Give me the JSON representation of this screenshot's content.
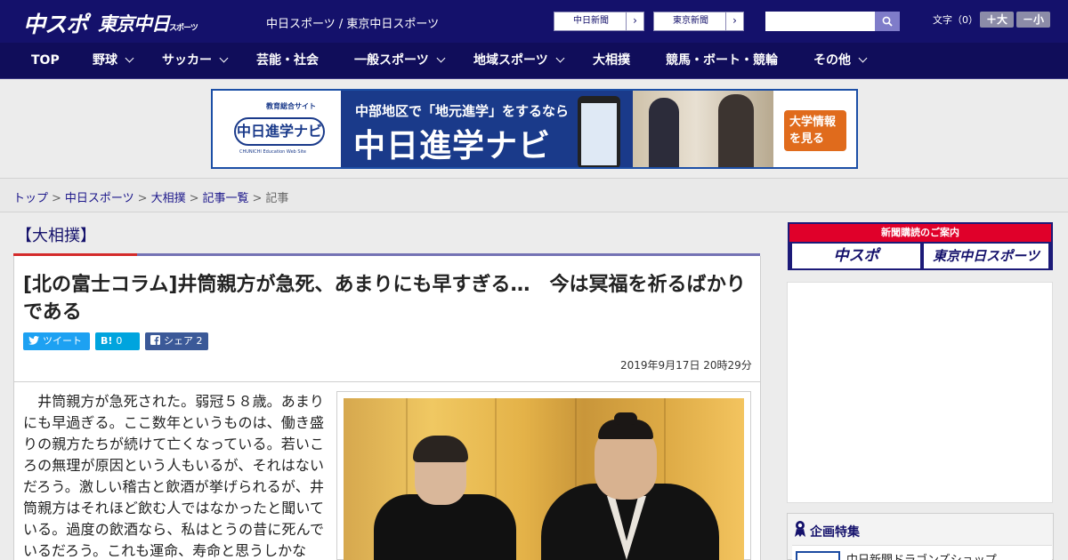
{
  "header": {
    "logo_chuspo": "中スポ",
    "logo_tokyo": "東京中日",
    "logo_tokyo_small": "スポーツ",
    "site_title": "中日スポーツ / 東京中日スポーツ",
    "ext_link_1": "中日新聞",
    "ext_link_2": "東京新聞",
    "ext_arrow": "›",
    "search_placeholder": "",
    "font_size_label": "文字（0）",
    "font_larger": "＋大",
    "font_smaller": "－小"
  },
  "nav": {
    "items": [
      {
        "label": "TOP",
        "has_dropdown": false
      },
      {
        "label": "野球",
        "has_dropdown": true
      },
      {
        "label": "サッカー",
        "has_dropdown": true
      },
      {
        "label": "芸能・社会",
        "has_dropdown": false
      },
      {
        "label": "一般スポーツ",
        "has_dropdown": true
      },
      {
        "label": "地域スポーツ",
        "has_dropdown": true
      },
      {
        "label": "大相撲",
        "has_dropdown": false
      },
      {
        "label": "競馬・ボート・競輪",
        "has_dropdown": false
      },
      {
        "label": "その他",
        "has_dropdown": true
      }
    ]
  },
  "banner": {
    "site_small": "教育総合サイト",
    "logo": "中日進学ナビ",
    "logo_en": "CHUNICHI Education Web Site",
    "line1": "中部地区で「地元進学」をするなら",
    "line2": "中日進学ナビ",
    "cta": "大学情報を見る"
  },
  "breadcrumb": {
    "items": [
      "トップ",
      "中日スポーツ",
      "大相撲",
      "記事一覧"
    ],
    "current": "記事",
    "separator": ">"
  },
  "article": {
    "category": "【大相撲】",
    "headline": "[北の富士コラム]井筒親方が急死、あまりにも早すぎる…　今は冥福を祈るばかりである",
    "share": {
      "tweet_label": "ツイート",
      "hatena_label": "B!",
      "hatena_count": "0",
      "facebook_label": "シェア",
      "facebook_count": "2"
    },
    "datetime": "2019年9月17日 20時29分",
    "body": "　井筒親方が急死された。弱冠５８歳。あまりにも早過ぎる。ここ数年というものは、働き盛りの親方たちが続けて亡くなっている。若いころの無理が原因という人もいるが、それはないだろう。激しい稽古と飲酒が挙げられるが、井筒親方はそれほど飲む人ではなかったと聞いている。過度の飲酒なら、私はとうの昔に死んでいるだろう。これも運命、寿命と思うしかな"
  },
  "sidebar": {
    "subscribe_title": "新聞購読のご案内",
    "subscribe_logo_1": "中スポ",
    "subscribe_logo_2": "東京中日スポーツ",
    "feature_title": "企画特集",
    "feature_item": "中日新聞ドラゴンズショップ"
  },
  "colors": {
    "header_bg": "#14116b",
    "nav_bg": "#100d5a",
    "accent_red": "#d42a2a",
    "twitter": "#1da1f2",
    "hatena": "#00a4de",
    "facebook": "#3b5998"
  }
}
